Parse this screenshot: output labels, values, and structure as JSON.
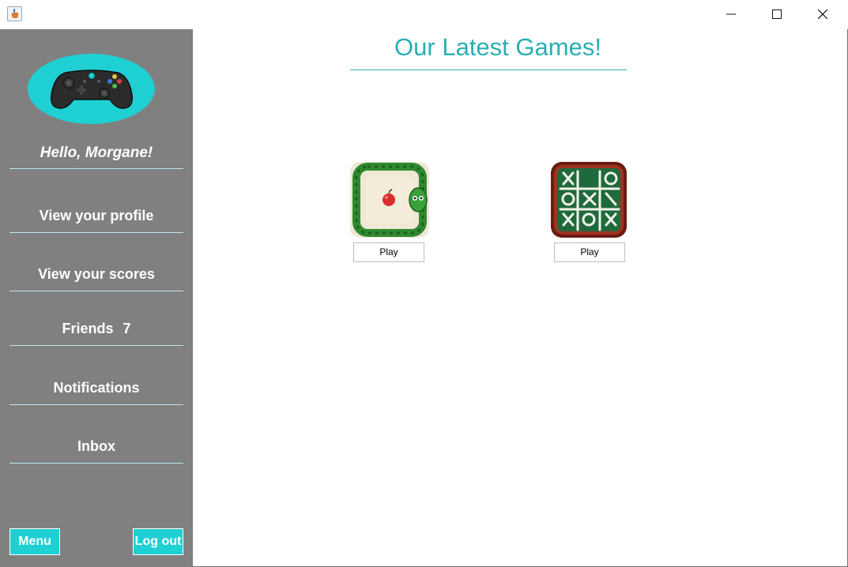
{
  "window": {
    "icons": {
      "app": "java-app-icon",
      "minimize": "minimize-icon",
      "maximize": "maximize-icon",
      "close": "close-icon"
    }
  },
  "sidebar": {
    "greeting": "Hello, Morgane!",
    "items": [
      {
        "label": "View your profile"
      },
      {
        "label": "View your scores"
      },
      {
        "label": "Friends",
        "count": "7"
      },
      {
        "label": "Notifications"
      },
      {
        "label": "Inbox"
      }
    ],
    "menu_label": "Menu",
    "logout_label": "Log out",
    "logo_icon": "gamepad-icon"
  },
  "main": {
    "title": "Our Latest Games!",
    "games": [
      {
        "icon": "snake-game-icon",
        "play_label": "Play"
      },
      {
        "icon": "tic-tac-toe-icon",
        "play_label": "Play"
      }
    ]
  },
  "colors": {
    "accent": "#1fd0d3",
    "title_teal": "#2aaeb2",
    "sidebar_bg": "#808080",
    "background": "#ffffff"
  }
}
